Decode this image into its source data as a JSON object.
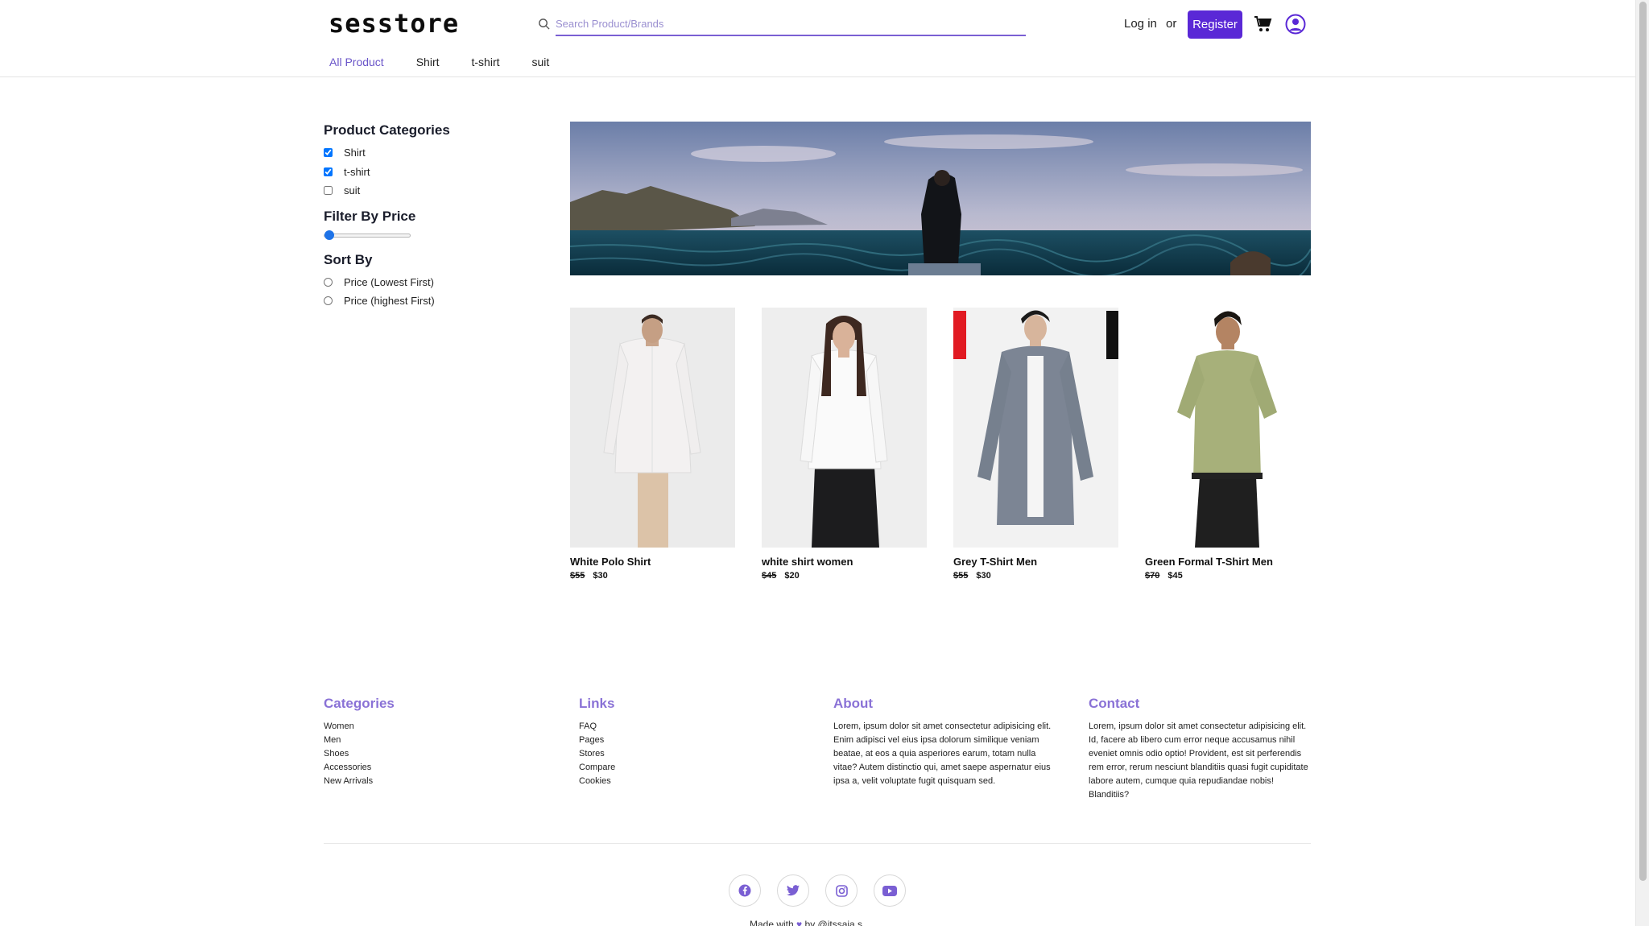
{
  "header": {
    "logo": "sesstore",
    "search_placeholder": "Search Product/Brands",
    "login_label": "Log in",
    "or_label": "or",
    "register_label": "Register",
    "accent_color": "#5a28d6"
  },
  "nav": [
    {
      "label": "All Product",
      "active": true
    },
    {
      "label": "Shirt"
    },
    {
      "label": "t-shirt"
    },
    {
      "label": "suit"
    }
  ],
  "sidebar": {
    "categories_title": "Product Categories",
    "categories": [
      {
        "label": "Shirt",
        "checked": true
      },
      {
        "label": "t-shirt",
        "checked": true
      },
      {
        "label": "suit",
        "checked": false
      }
    ],
    "price_title": "Filter By Price",
    "price_slider_value": 0,
    "sort_title": "Sort By",
    "sort_options": [
      {
        "label": "Price (Lowest First)",
        "selected": false
      },
      {
        "label": "Price (highest First)",
        "selected": false
      }
    ]
  },
  "products": [
    {
      "name": "White Polo Shirt",
      "old_price": "$55",
      "price": "$30"
    },
    {
      "name": "white shirt women",
      "old_price": "$45",
      "price": "$20"
    },
    {
      "name": "Grey T-Shirt Men",
      "old_price": "$55",
      "price": "$30"
    },
    {
      "name": "Green Formal T-Shirt Men",
      "old_price": "$70",
      "price": "$45"
    }
  ],
  "footer": {
    "categories_title": "Categories",
    "categories": [
      "Women",
      "Men",
      "Shoes",
      "Accessories",
      "New Arrivals"
    ],
    "links_title": "Links",
    "links": [
      "FAQ",
      "Pages",
      "Stores",
      "Compare",
      "Cookies"
    ],
    "about_title": "About",
    "about_text": "Lorem, ipsum dolor sit amet consectetur adipisicing elit. Enim adipisci vel eius ipsa dolorum similique veniam beatae, at eos a quia asperiores earum, totam nulla vitae? Autem distinctio qui, amet saepe aspernatur eius ipsa a, velit voluptate fugit quisquam sed.",
    "contact_title": "Contact",
    "contact_text": "Lorem, ipsum dolor sit amet consectetur adipisicing elit. Id, facere ab libero cum error neque accusamus nihil eveniet omnis odio optio! Provident, est sit perferendis rem error, rerum nesciunt blanditiis quasi fugit cupiditate labore autem, cumque quia repudiandae nobis! Blanditiis?",
    "social_icons": [
      "facebook-icon",
      "twitter-icon",
      "instagram-icon",
      "youtube-icon"
    ],
    "made_with_prefix": "Made with",
    "made_with_suffix": "by @itssaja.s"
  }
}
